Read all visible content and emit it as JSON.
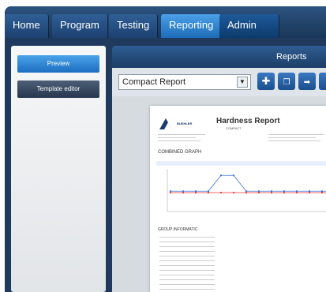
{
  "tabs": [
    {
      "label": "Home"
    },
    {
      "label": "Program"
    },
    {
      "label": "Testing"
    },
    {
      "label": "Reporting"
    },
    {
      "label": "Admin"
    }
  ],
  "sidebar": {
    "preview_label": "Preview",
    "template_label": "Template editor"
  },
  "main": {
    "title": "Reports",
    "report_select": "Compact Report",
    "toolbar_icons": [
      "add-icon",
      "copy-icon",
      "export-icon"
    ]
  },
  "document": {
    "logo_text": "BUEHLER",
    "title": "Hardness Report",
    "subtitle": "COMPACT",
    "combined_graph": "COMBINED GRAPH",
    "group_information": "GROUP INFORMATIC"
  },
  "colors": {
    "tab_active": "#3a8fe0",
    "series_blue": "#3b6fd6",
    "series_red": "#d9352c"
  },
  "chart_data": {
    "type": "line",
    "series": [
      {
        "values": [
          380,
          380,
          380,
          380,
          700,
          700,
          380,
          380,
          380,
          380,
          380,
          380,
          380,
          380
        ]
      },
      {
        "values": [
          350,
          350,
          350,
          350,
          350,
          350,
          350,
          350,
          350,
          350,
          350,
          350,
          350,
          350
        ]
      }
    ],
    "ylim": [
      0,
      800
    ]
  }
}
